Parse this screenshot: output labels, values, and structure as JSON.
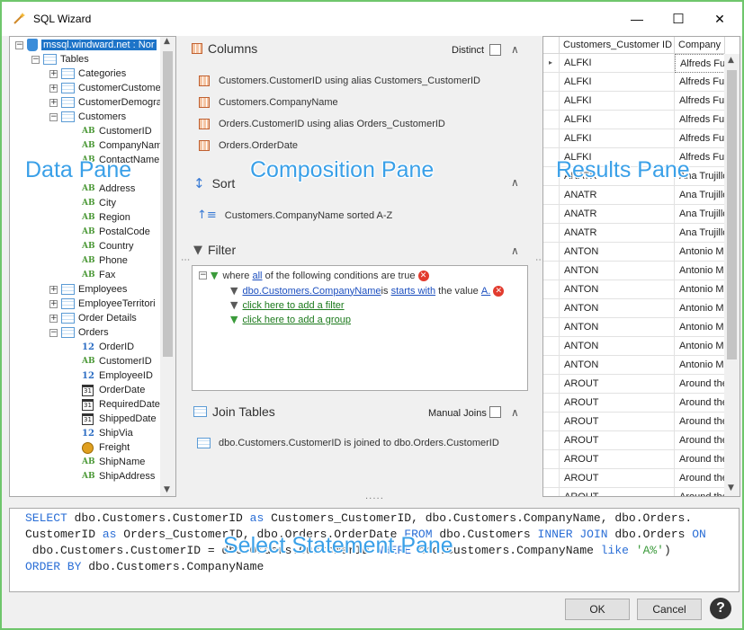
{
  "window": {
    "title": "SQL Wizard",
    "minimize_glyph": "—",
    "maximize_glyph": "☐",
    "close_glyph": "✕"
  },
  "data_pane": {
    "connection": "mssql.windward.net : Nor",
    "tables_label": "Tables",
    "tables": [
      "Categories",
      "CustomerCustome",
      "CustomerDemogra",
      "Customers"
    ],
    "customer_columns": [
      "CustomerID",
      "CompanyNam",
      "ContactName",
      "Address",
      "City",
      "Region",
      "PostalCode",
      "Country",
      "Phone",
      "Fax"
    ],
    "tables2": [
      "Employees",
      "EmployeeTerritori",
      "Order Details",
      "Orders"
    ],
    "orders_columns": [
      {
        "name": "OrderID",
        "type": "number"
      },
      {
        "name": "CustomerID",
        "type": "text"
      },
      {
        "name": "EmployeeID",
        "type": "number"
      },
      {
        "name": "OrderDate",
        "type": "date"
      },
      {
        "name": "RequiredDate",
        "type": "date"
      },
      {
        "name": "ShippedDate",
        "type": "date"
      },
      {
        "name": "ShipVia",
        "type": "number"
      },
      {
        "name": "Freight",
        "type": "money"
      },
      {
        "name": "ShipName",
        "type": "text"
      },
      {
        "name": "ShipAddress",
        "type": "text"
      }
    ],
    "text_type_glyph": "AB",
    "number_type_glyph": "12",
    "date_type_glyph": "31"
  },
  "composition": {
    "columns_title": "Columns",
    "distinct_label": "Distinct",
    "columns": [
      "Customers.CustomerID using alias Customers_CustomerID",
      "Customers.CompanyName",
      "Orders.CustomerID using alias Orders_CustomerID",
      "Orders.OrderDate"
    ],
    "sort_title": "Sort",
    "sort_item": "Customers.CompanyName sorted A-Z",
    "filter_title": "Filter",
    "filter": {
      "where": "where",
      "all": "all",
      "conditions": "of the following conditions are true",
      "field": "dbo.Customers.CompanyName",
      "is": "is",
      "op": "starts with",
      "the_value": "the value",
      "value": "A.",
      "add_filter": "click here to add a filter",
      "add_group": "click here to add a group"
    },
    "join_title": "Join Tables",
    "manual_joins_label": "Manual Joins",
    "join_item": "dbo.Customers.CustomerID is joined to dbo.Orders.CustomerID"
  },
  "results": {
    "headers": [
      "Customers_Customer ID",
      "Company Nam"
    ],
    "rows": [
      [
        "ALFKI",
        "Alfreds Fut"
      ],
      [
        "ALFKI",
        "Alfreds Fut"
      ],
      [
        "ALFKI",
        "Alfreds Fut"
      ],
      [
        "ALFKI",
        "Alfreds Fut"
      ],
      [
        "ALFKI",
        "Alfreds Fut"
      ],
      [
        "ALFKI",
        "Alfreds Fut"
      ],
      [
        "ANATR",
        "Ana Trujillo"
      ],
      [
        "ANATR",
        "Ana Trujillo"
      ],
      [
        "ANATR",
        "Ana Trujillo"
      ],
      [
        "ANATR",
        "Ana Trujillo"
      ],
      [
        "ANTON",
        "Antonio Mo"
      ],
      [
        "ANTON",
        "Antonio Mo"
      ],
      [
        "ANTON",
        "Antonio Mo"
      ],
      [
        "ANTON",
        "Antonio Mo"
      ],
      [
        "ANTON",
        "Antonio Mo"
      ],
      [
        "ANTON",
        "Antonio Mo"
      ],
      [
        "ANTON",
        "Antonio Mo"
      ],
      [
        "AROUT",
        "Around the"
      ],
      [
        "AROUT",
        "Around the"
      ],
      [
        "AROUT",
        "Around the"
      ],
      [
        "AROUT",
        "Around the"
      ],
      [
        "AROUT",
        "Around the"
      ],
      [
        "AROUT",
        "Around the"
      ],
      [
        "AROUT",
        "Around the"
      ]
    ]
  },
  "sql": {
    "l1a": "SELECT",
    "l1b": " dbo.Customers.CustomerID ",
    "l1c": "as",
    "l1d": " Customers_CustomerID, dbo.Customers.CompanyName, dbo.Orders.",
    "l2a": "CustomerID ",
    "l2b": "as",
    "l2c": " Orders_CustomerID, dbo.Orders.OrderDate ",
    "l2d": "FROM",
    "l2e": " dbo.Customers ",
    "l2f": "INNER JOIN",
    "l2g": " dbo.Orders ",
    "l2h": "ON",
    "l3a": " dbo.Customers.CustomerID = dbo.Orders.CustomerID ",
    "l3b": "WHERE",
    "l3c": " dbo.Customers.CompanyName ",
    "l3d": "like",
    "l3e": " ",
    "l3f": "'A%'",
    "l3g": ")",
    "l4a": "ORDER BY",
    "l4b": " dbo.Customers.CompanyName"
  },
  "overlays": {
    "data": "Data Pane",
    "composition": "Composition Pane",
    "results": "Results Pane",
    "select": "Select Statement Pane"
  },
  "footer": {
    "ok": "OK",
    "cancel": "Cancel",
    "help": "?"
  },
  "colors": {
    "accent": "#3aa0e8",
    "border": "#6fc66c",
    "keyword": "#2a6ed6",
    "string": "#3a9a3a"
  }
}
